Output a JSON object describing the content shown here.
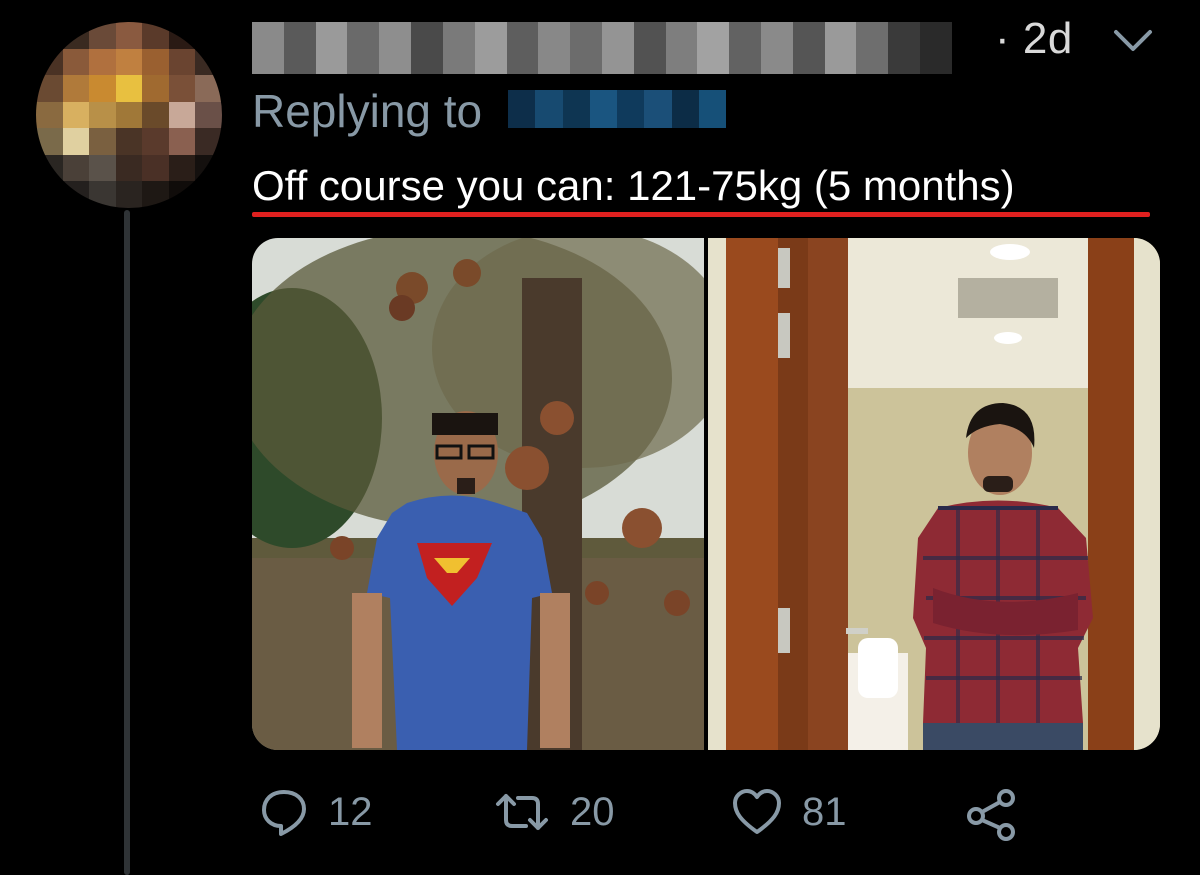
{
  "tweet": {
    "timestamp": "· 2d",
    "replying_label": "Replying to",
    "text": "Off course you can: 121-75kg (5 months)",
    "actions": {
      "reply_count": "12",
      "retweet_count": "20",
      "like_count": "81"
    }
  },
  "icons": {
    "more": "chevron-down-icon",
    "reply": "speech-bubble-icon",
    "retweet": "retweet-icon",
    "like": "heart-icon",
    "share": "share-icon"
  },
  "colors": {
    "background": "#000000",
    "secondary_text": "#8899a6",
    "highlight_underline": "#e0201f"
  }
}
